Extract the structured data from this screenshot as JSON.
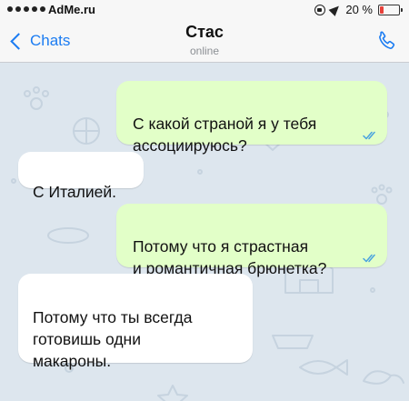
{
  "status_bar": {
    "carrier": "AdMe.ru",
    "battery_text": "20 %",
    "battery_level": 0.2,
    "icons": [
      "signal-dots-icon",
      "rotation-lock-icon",
      "location-arrow-icon",
      "battery-icon"
    ]
  },
  "nav": {
    "back_label": "Chats",
    "title": "Стас",
    "subtitle": "online",
    "back_icon": "chevron-left-icon",
    "call_icon": "phone-icon"
  },
  "colors": {
    "accent": "#1b7cf2",
    "outgoing_bubble": "#e2ffc8",
    "incoming_bubble": "#ffffff",
    "chat_background": "#dde6ee",
    "read_ticks": "#4aa3df",
    "battery_low": "#e8403a"
  },
  "messages": [
    {
      "direction": "outgoing",
      "text": "С какой страной я у тебя\nассоциируюсь?",
      "status": "read"
    },
    {
      "direction": "incoming",
      "text": "С Италией."
    },
    {
      "direction": "outgoing",
      "text": "Потому что я страстная\nи романтичная брюнетка?",
      "status": "read"
    },
    {
      "direction": "incoming",
      "text": "Потому что ты всегда\nготовишь одни\nмакароны."
    }
  ]
}
